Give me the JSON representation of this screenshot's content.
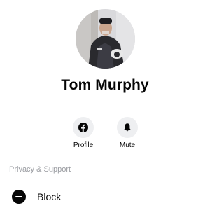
{
  "profile": {
    "name": "Tom Murphy"
  },
  "actions": [
    {
      "label": "Profile",
      "icon": "facebook-icon"
    },
    {
      "label": "Mute",
      "icon": "bell-icon"
    }
  ],
  "sections": {
    "privacy_support": {
      "title": "Privacy & Support",
      "items": [
        {
          "label": "Block",
          "icon": "block-icon"
        }
      ]
    }
  },
  "colors": {
    "text": "#050505",
    "muted": "#9a9ca1",
    "icon_bg": "#eeeff1"
  }
}
